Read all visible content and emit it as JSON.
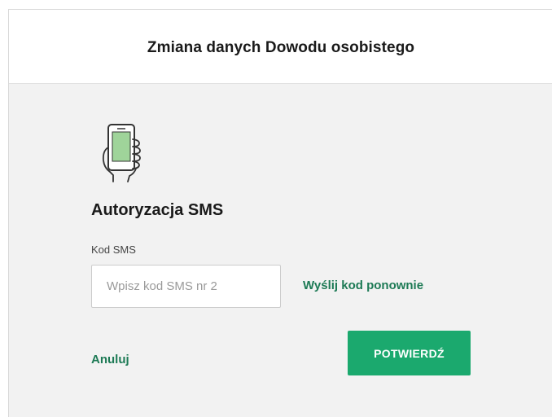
{
  "dialog": {
    "title": "Zmiana danych Dowodu osobistego"
  },
  "auth": {
    "icon": "phone-icon",
    "section_title": "Autoryzacja SMS",
    "field_label": "Kod SMS",
    "input_placeholder": "Wpisz kod SMS nr 2",
    "input_value": "",
    "resend_label": "Wyślij kod ponownie"
  },
  "actions": {
    "cancel_label": "Anuluj",
    "confirm_label": "POTWIERDŹ"
  },
  "colors": {
    "accent_green": "#1ba96e",
    "link_green": "#1d7a55",
    "phone_screen": "#9fd49a",
    "body_bg": "#f2f2f2"
  }
}
